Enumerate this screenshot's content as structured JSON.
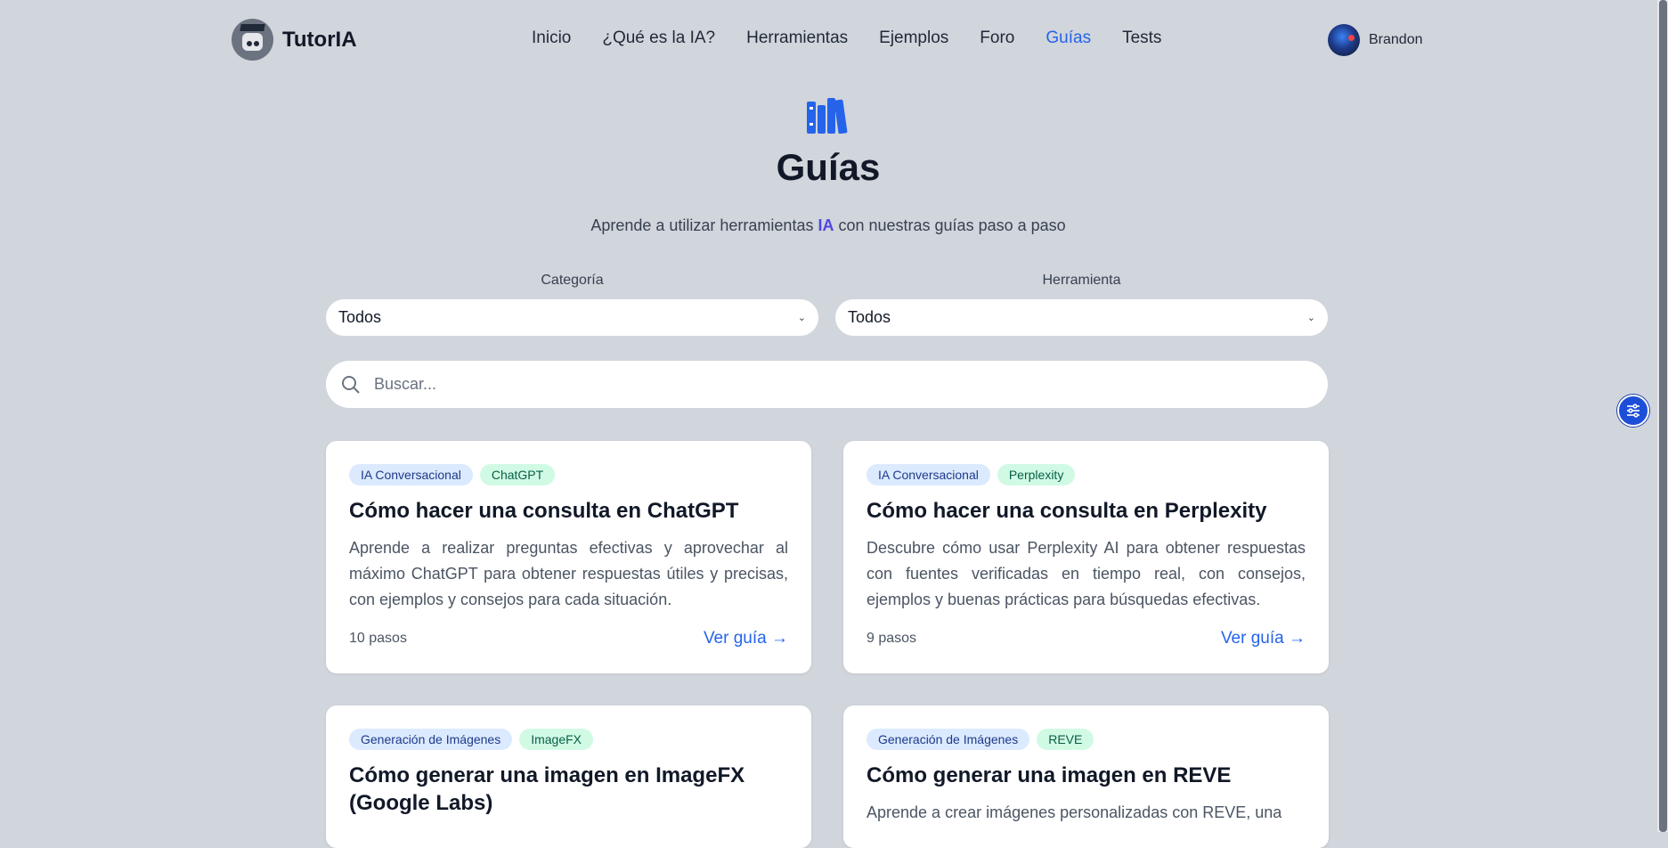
{
  "header": {
    "logo_text": "TutorIA",
    "nav": [
      {
        "label": "Inicio",
        "active": false
      },
      {
        "label": "¿Qué es la IA?",
        "active": false
      },
      {
        "label": "Herramientas",
        "active": false
      },
      {
        "label": "Ejemplos",
        "active": false
      },
      {
        "label": "Foro",
        "active": false
      },
      {
        "label": "Guías",
        "active": true
      },
      {
        "label": "Tests",
        "active": false
      }
    ],
    "user_name": "Brandon"
  },
  "hero": {
    "icon": "books-icon",
    "title": "Guías",
    "subtitle_before": "Aprende a utilizar herramientas ",
    "subtitle_highlight": "IA",
    "subtitle_after": " con nuestras guías paso a paso"
  },
  "filters": {
    "category_label": "Categoría",
    "category_value": "Todos",
    "tool_label": "Herramienta",
    "tool_value": "Todos",
    "search_placeholder": "Buscar..."
  },
  "guides": [
    {
      "category": "IA Conversacional",
      "tool": "ChatGPT",
      "title": "Cómo hacer una consulta en ChatGPT",
      "description": "Aprende a realizar preguntas efectivas y aprovechar al máximo ChatGPT para obtener respuestas útiles y precisas, con ejemplos y consejos para cada situación.",
      "steps": "10 pasos",
      "link": "Ver guía →"
    },
    {
      "category": "IA Conversacional",
      "tool": "Perplexity",
      "title": "Cómo hacer una consulta en Perplexity",
      "description": "Descubre cómo usar Perplexity AI para obtener respuestas con fuentes verificadas en tiempo real, con consejos, ejemplos y buenas prácticas para búsquedas efectivas.",
      "steps": "9 pasos",
      "link": "Ver guía →"
    },
    {
      "category": "Generación de Imágenes",
      "tool": "ImageFX",
      "title": "Cómo generar una imagen en ImageFX (Google Labs)",
      "description": "",
      "steps": "",
      "link": ""
    },
    {
      "category": "Generación de Imágenes",
      "tool": "REVE",
      "title": "Cómo generar una imagen en REVE",
      "description": "Aprende a crear imágenes personalizadas con REVE, una",
      "steps": "",
      "link": ""
    }
  ],
  "colors": {
    "background": "#d1d5dc",
    "accent": "#2563eb",
    "highlight": "#4f46e5",
    "category_tag_bg": "#dbeafe",
    "tool_tag_bg": "#d1fae5"
  }
}
